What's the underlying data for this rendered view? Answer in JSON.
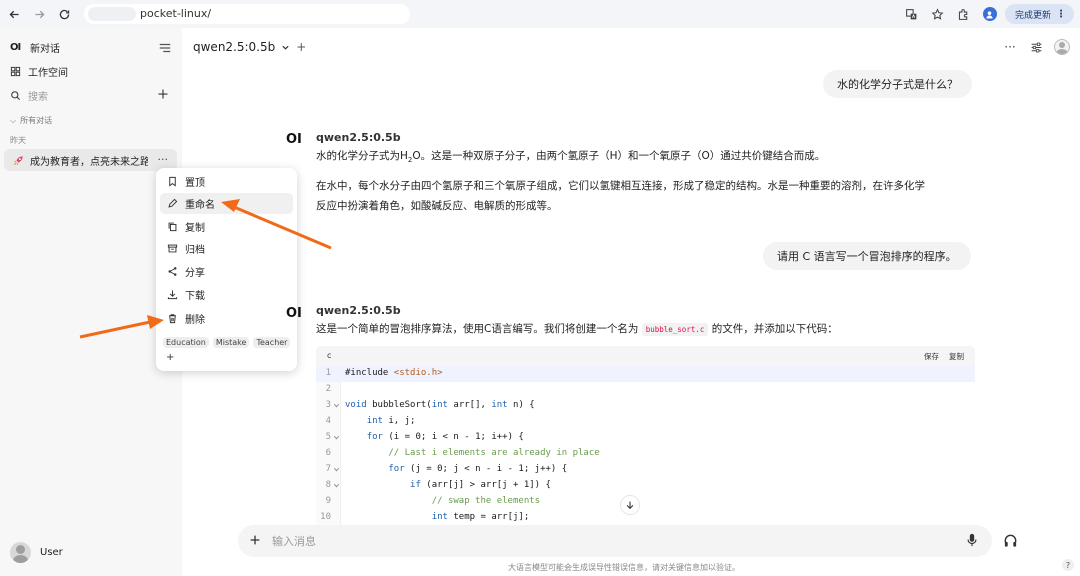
{
  "browser": {
    "url": "pocket-linux/",
    "update_label": "完成更新"
  },
  "sidebar": {
    "new_chat": "新对话",
    "workspace": "工作空间",
    "search_placeholder": "搜索",
    "section": "所有对话",
    "date_group": "昨天",
    "chat_item": "成为教育者，点亮未来之路",
    "user_name": "User"
  },
  "context_menu": {
    "items": [
      "置顶",
      "重命名",
      "复制",
      "归档",
      "分享",
      "下载",
      "删除"
    ],
    "tags": [
      "Education",
      "Mistake",
      "Teacher"
    ],
    "add_tag": "+"
  },
  "header": {
    "model": "qwen2.5:0.5b"
  },
  "chat": {
    "user_message_1": "水的化学分子式是什么？",
    "ai_name": "qwen2.5:0.5b",
    "ai_reply_1_line1_pre": "水的化学分子式为H",
    "ai_reply_1_sub": "2",
    "ai_reply_1_line1_post": "O。这是一种双原子分子，由两个氢原子（H）和一个氧原子（O）通过共价键结合而成。",
    "ai_reply_1_para2_line1": "在水中，每个水分子由四个氢原子和三个氧原子组成，它们以氢键相互连接，形成了稳定的结构。水是一种重要的溶剂，在许多化学",
    "ai_reply_1_para2_line2": "反应中扮演着角色，如酸碱反应、电解质的形成等。",
    "user_message_2": "请用 C 语言写一个冒泡排序的程序。",
    "ai_reply_2_pre": "这是一个简单的冒泡排序算法，使用C语言编写。我们将创建一个名为",
    "ai_reply_2_code": "bubble_sort.c",
    "ai_reply_2_post": "的文件，并添加以下代码："
  },
  "code_block": {
    "language": "c",
    "save_label": "保存",
    "copy_label": "复制",
    "line_numbers": [
      "1",
      "2",
      "3",
      "4",
      "5",
      "6",
      "7",
      "8",
      "9",
      "10"
    ],
    "lines": [
      "#include <stdio.h>",
      "",
      "void bubbleSort(int arr[], int n) {",
      "    int i, j;",
      "    for (i = 0; i < n - 1; i++) {",
      "        // Last i elements are already in place",
      "        for (j = 0; j < n - i - 1; j++) {",
      "            if (arr[j] > arr[j + 1]) {",
      "                // swap the elements",
      "                int temp = arr[j];"
    ]
  },
  "composer": {
    "placeholder": "输入消息"
  },
  "footer": {
    "disclaimer": "大语言模型可能会生成误导性错误信息，请对关键信息加以验证。",
    "help": "?"
  },
  "colors": {
    "annotation_arrow": "#f06a1a",
    "keyword": "#1f5fb0",
    "string": "#b35a20",
    "comment": "#6a9b4e"
  }
}
